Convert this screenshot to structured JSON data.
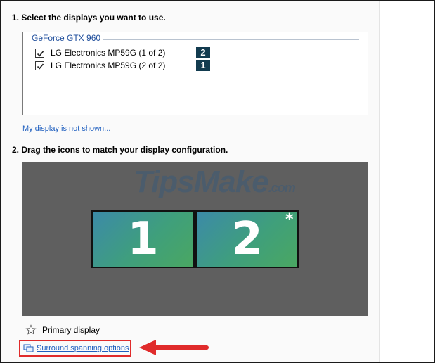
{
  "step1": {
    "title": "1. Select the displays you want to use."
  },
  "gpu": {
    "name": "GeForce GTX 960",
    "displays": [
      {
        "label": "LG Electronics MP59G (1 of 2)",
        "checked": true,
        "badge": "2"
      },
      {
        "label": "LG Electronics MP59G (2 of 2)",
        "checked": true,
        "badge": "1"
      }
    ]
  },
  "not_shown_link": "My display is not shown...",
  "step2": {
    "title": "2. Drag the icons to match your display configuration."
  },
  "arrangement": {
    "watermark": "TipsMake",
    "watermark_suffix": ".com",
    "monitors": [
      {
        "number": "1"
      },
      {
        "number": "2",
        "primary_marker": "*"
      }
    ]
  },
  "legend": {
    "primary_label": "Primary display"
  },
  "surround_link": "Surround spanning options",
  "colors": {
    "link": "#1f5fbf",
    "badge": "#123b4f",
    "highlight": "#e02b2b",
    "canvas": "#5f5f5f"
  }
}
